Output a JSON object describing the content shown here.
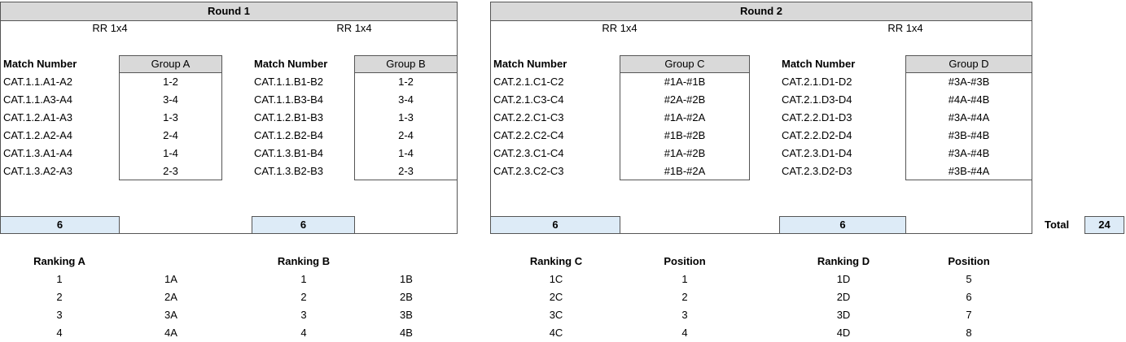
{
  "round1": {
    "title": "Round 1",
    "format_left": "RR 1x4",
    "format_right": "RR 1x4",
    "match_label": "Match Number",
    "groupA": {
      "name": "Group A",
      "matches": [
        "CAT.1.1.A1-A2",
        "CAT.1.1.A3-A4",
        "CAT.1.2.A1-A3",
        "CAT.1.2.A2-A4",
        "CAT.1.3.A1-A4",
        "CAT.1.3.A2-A3"
      ],
      "pairs": [
        "1-2",
        "3-4",
        "1-3",
        "2-4",
        "1-4",
        "2-3"
      ],
      "count": "6"
    },
    "groupB": {
      "name": "Group B",
      "matches": [
        "CAT.1.1.B1-B2",
        "CAT.1.1.B3-B4",
        "CAT.1.2.B1-B3",
        "CAT.1.2.B2-B4",
        "CAT.1.3.B1-B4",
        "CAT.1.3.B2-B3"
      ],
      "pairs": [
        "1-2",
        "3-4",
        "1-3",
        "2-4",
        "1-4",
        "2-3"
      ],
      "count": "6"
    }
  },
  "round2": {
    "title": "Round 2",
    "format_left": "RR 1x4",
    "format_right": "RR 1x4",
    "match_label": "Match Number",
    "groupC": {
      "name": "Group C",
      "matches": [
        "CAT.2.1.C1-C2",
        "CAT.2.1.C3-C4",
        "CAT.2.2.C1-C3",
        "CAT.2.2.C2-C4",
        "CAT.2.3.C1-C4",
        "CAT.2.3.C2-C3"
      ],
      "pairs": [
        "#1A-#1B",
        "#2A-#2B",
        "#1A-#2A",
        "#1B-#2B",
        "#1A-#2B",
        "#1B-#2A"
      ],
      "count": "6"
    },
    "groupD": {
      "name": "Group D",
      "matches": [
        "CAT.2.1.D1-D2",
        "CAT.2.1.D3-D4",
        "CAT.2.2.D1-D3",
        "CAT.2.2.D2-D4",
        "CAT.2.3.D1-D4",
        "CAT.2.3.D2-D3"
      ],
      "pairs": [
        "#3A-#3B",
        "#4A-#4B",
        "#3A-#4A",
        "#3B-#4B",
        "#3A-#4B",
        "#3B-#4A"
      ],
      "count": "6"
    }
  },
  "total": {
    "label": "Total",
    "value": "24"
  },
  "rankings": {
    "A": {
      "label": "Ranking A",
      "ranks": [
        "1",
        "2",
        "3",
        "4"
      ],
      "codes": [
        "1A",
        "2A",
        "3A",
        "4A"
      ]
    },
    "B": {
      "label": "Ranking B",
      "ranks": [
        "1",
        "2",
        "3",
        "4"
      ],
      "codes": [
        "1B",
        "2B",
        "3B",
        "4B"
      ]
    },
    "C": {
      "label": "Ranking C",
      "position_label": "Position",
      "codes": [
        "1C",
        "2C",
        "3C",
        "4C"
      ],
      "positions": [
        "1",
        "2",
        "3",
        "4"
      ]
    },
    "D": {
      "label": "Ranking D",
      "position_label": "Position",
      "codes": [
        "1D",
        "2D",
        "3D",
        "4D"
      ],
      "positions": [
        "5",
        "6",
        "7",
        "8"
      ]
    }
  }
}
